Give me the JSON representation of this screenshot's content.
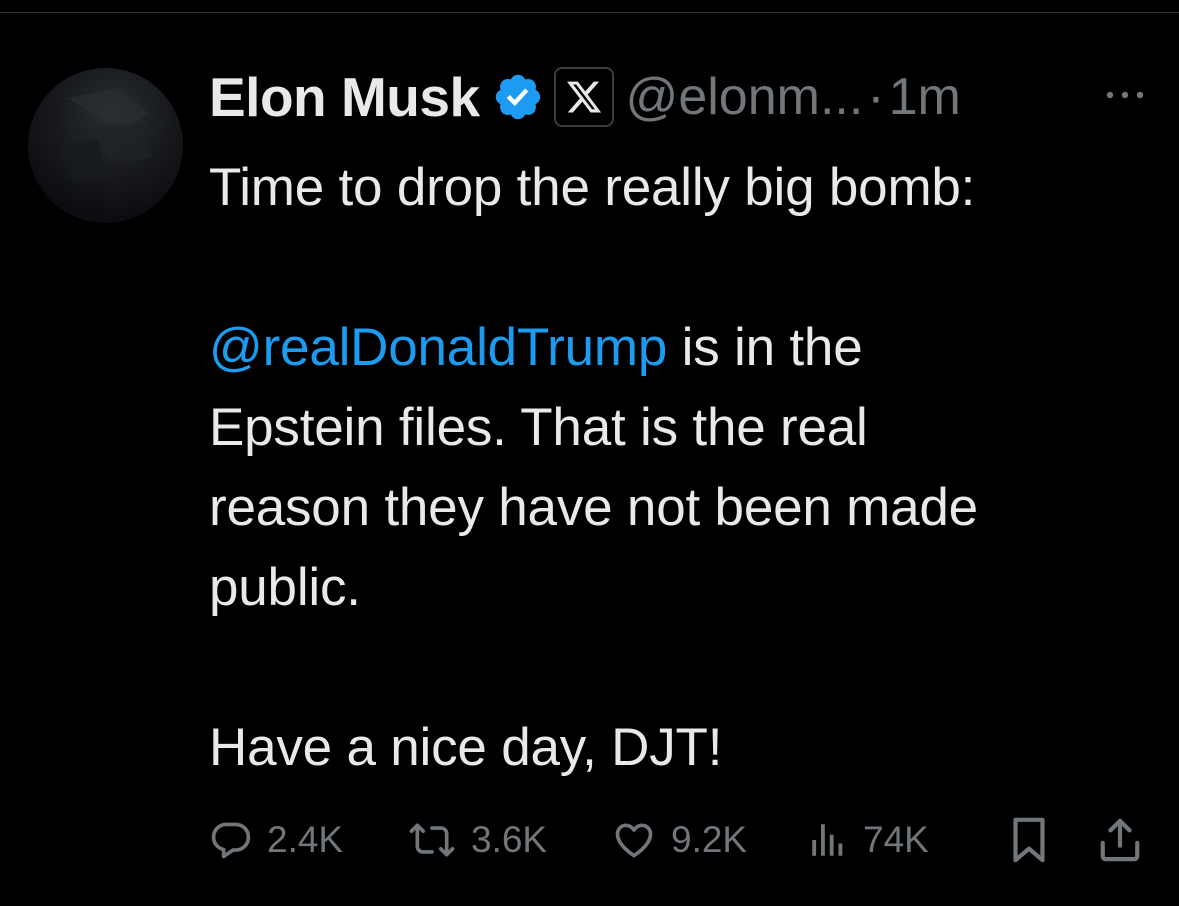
{
  "post": {
    "author": {
      "name": "Elon Musk",
      "handle": "@elonm...",
      "verified_icon": "verified-badge-icon",
      "affiliate_icon": "x-logo-icon",
      "verified_color": "#1d9bf0"
    },
    "separator": "·",
    "time": "1m",
    "more_icon": "more-horizontal-icon",
    "text": {
      "line1": "Time to drop the really big bomb:",
      "mention": "@realDonaldTrump",
      "after_mention": " is in the\nEpstein files. That is the real\nreason they have not been made\npublic.",
      "closing": "Have a nice day, DJT!"
    },
    "actions": {
      "replies": {
        "icon": "reply-icon",
        "count": "2.4K"
      },
      "reposts": {
        "icon": "repost-icon",
        "count": "3.6K"
      },
      "likes": {
        "icon": "like-icon",
        "count": "9.2K"
      },
      "views": {
        "icon": "views-icon",
        "count": "74K"
      },
      "bookmark": {
        "icon": "bookmark-icon"
      },
      "share": {
        "icon": "share-icon"
      }
    },
    "colors": {
      "background": "#000000",
      "text": "#e7e9ea",
      "muted": "#71767b",
      "link": "#1d9bf0"
    }
  }
}
